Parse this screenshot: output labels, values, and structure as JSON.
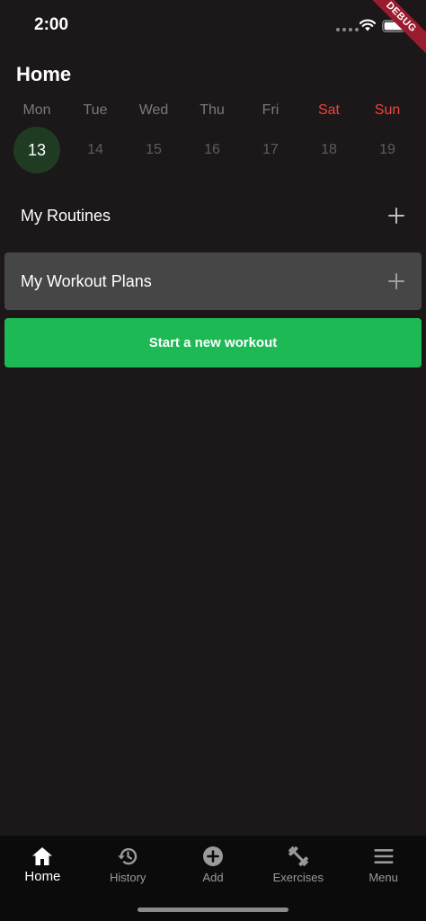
{
  "status_bar": {
    "time": "2:00",
    "debug_label": "DEBUG"
  },
  "header": {
    "title": "Home"
  },
  "week": {
    "days": [
      {
        "name": "Mon",
        "date": "13",
        "selected": true,
        "weekend": false
      },
      {
        "name": "Tue",
        "date": "14",
        "selected": false,
        "weekend": false
      },
      {
        "name": "Wed",
        "date": "15",
        "selected": false,
        "weekend": false
      },
      {
        "name": "Thu",
        "date": "16",
        "selected": false,
        "weekend": false
      },
      {
        "name": "Fri",
        "date": "17",
        "selected": false,
        "weekend": false
      },
      {
        "name": "Sat",
        "date": "18",
        "selected": false,
        "weekend": true
      },
      {
        "name": "Sun",
        "date": "19",
        "selected": false,
        "weekend": true
      }
    ]
  },
  "sections": {
    "routines_label": "My Routines",
    "plans_label": "My Workout Plans"
  },
  "actions": {
    "start_workout_label": "Start a new workout"
  },
  "bottom_nav": {
    "items": [
      {
        "label": "Home",
        "icon": "home-icon",
        "active": true
      },
      {
        "label": "History",
        "icon": "history-icon",
        "active": false
      },
      {
        "label": "Add",
        "icon": "add-circle-icon",
        "active": false
      },
      {
        "label": "Exercises",
        "icon": "dumbbell-icon",
        "active": false
      },
      {
        "label": "Menu",
        "icon": "menu-icon",
        "active": false
      }
    ]
  },
  "colors": {
    "background": "#1c1718",
    "accent_green": "#1db954",
    "selected_day": "#1f3c22",
    "weekend_red": "#f0453b",
    "plans_row": "#464646",
    "nav_background": "#0b0b0b"
  }
}
